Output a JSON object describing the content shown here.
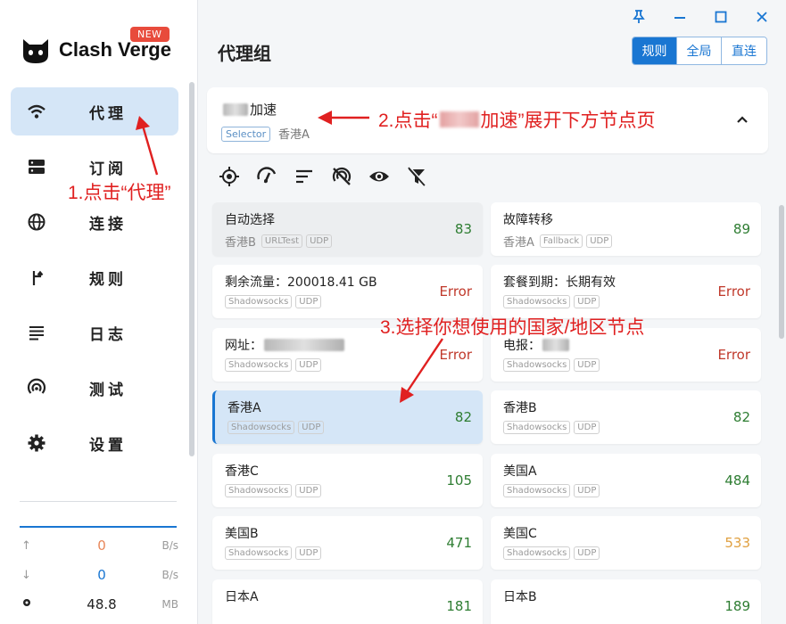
{
  "app": {
    "logo_text": "Clash Verge",
    "new_badge": "NEW"
  },
  "window_controls": [
    "pin-icon",
    "minimize-icon",
    "maximize-icon",
    "close-icon"
  ],
  "sidebar": {
    "items": [
      {
        "label": "代理",
        "icon": "wifi-icon",
        "active": true
      },
      {
        "label": "订阅",
        "icon": "server-icon",
        "active": false
      },
      {
        "label": "连接",
        "icon": "globe-icon",
        "active": false
      },
      {
        "label": "规则",
        "icon": "fork-icon",
        "active": false
      },
      {
        "label": "日志",
        "icon": "list-icon",
        "active": false
      },
      {
        "label": "测试",
        "icon": "signal-icon",
        "active": false
      },
      {
        "label": "设置",
        "icon": "gear-icon",
        "active": false
      }
    ],
    "traffic": {
      "upload": {
        "value": "0",
        "unit": "B/s"
      },
      "download": {
        "value": "0",
        "unit": "B/s"
      },
      "memory": {
        "value": "48.8",
        "unit": "MB"
      }
    }
  },
  "main": {
    "title": "代理组",
    "modes": [
      {
        "label": "规则",
        "active": true
      },
      {
        "label": "全局",
        "active": false
      },
      {
        "label": "直连",
        "active": false
      }
    ],
    "group": {
      "name_suffix": "加速",
      "type": "Selector",
      "now": "香港A"
    },
    "toolbar_icons": [
      "locate-icon",
      "speed-test-icon",
      "sort-icon",
      "filter-off-icon",
      "eye-icon",
      "funnel-x-icon"
    ],
    "nodes": [
      {
        "name": "自动选择",
        "now": "香港B",
        "tags": [
          "URLTest",
          "UDP"
        ],
        "delay": "83",
        "state": "green"
      },
      {
        "name": "故障转移",
        "now": "香港A",
        "tags": [
          "Fallback",
          "UDP"
        ],
        "delay": "89",
        "state": "green"
      },
      {
        "name": "剩余流量：200018.41 GB",
        "tags": [
          "Shadowsocks",
          "UDP"
        ],
        "delay": "Error",
        "state": "red"
      },
      {
        "name": "套餐到期：长期有效",
        "tags": [
          "Shadowsocks",
          "UDP"
        ],
        "delay": "Error",
        "state": "red"
      },
      {
        "name": "网址：",
        "tags": [
          "Shadowsocks",
          "UDP"
        ],
        "delay": "Error",
        "state": "red"
      },
      {
        "name": "电报：",
        "tags": [
          "Shadowsocks",
          "UDP"
        ],
        "delay": "Error",
        "state": "red"
      },
      {
        "name": "香港A",
        "tags": [
          "Shadowsocks",
          "UDP"
        ],
        "delay": "82",
        "state": "green"
      },
      {
        "name": "香港B",
        "tags": [
          "Shadowsocks",
          "UDP"
        ],
        "delay": "82",
        "state": "green"
      },
      {
        "name": "香港C",
        "tags": [
          "Shadowsocks",
          "UDP"
        ],
        "delay": "105",
        "state": "green"
      },
      {
        "name": "美国A",
        "tags": [
          "Shadowsocks",
          "UDP"
        ],
        "delay": "484",
        "state": "green"
      },
      {
        "name": "美国B",
        "tags": [
          "Shadowsocks",
          "UDP"
        ],
        "delay": "471",
        "state": "green"
      },
      {
        "name": "美国C",
        "tags": [
          "Shadowsocks",
          "UDP"
        ],
        "delay": "533",
        "state": "orange"
      },
      {
        "name": "日本A",
        "tags": [],
        "delay": "181",
        "state": "green"
      },
      {
        "name": "日本B",
        "tags": [],
        "delay": "189",
        "state": "green"
      }
    ]
  },
  "annotations": {
    "step1": "1.点击“代理”",
    "step2_prefix": "2.点击“",
    "step2_suffix": "加速”展开下方节点页",
    "step3": "3.选择你想使用的国家/地区节点"
  },
  "colors": {
    "accent": "#1976d2",
    "active_bg": "#d5e6f7",
    "annotation": "#e02020",
    "delay_ok": "#2e7d32",
    "delay_warn": "#e0a040",
    "delay_error": "#c0392b"
  }
}
